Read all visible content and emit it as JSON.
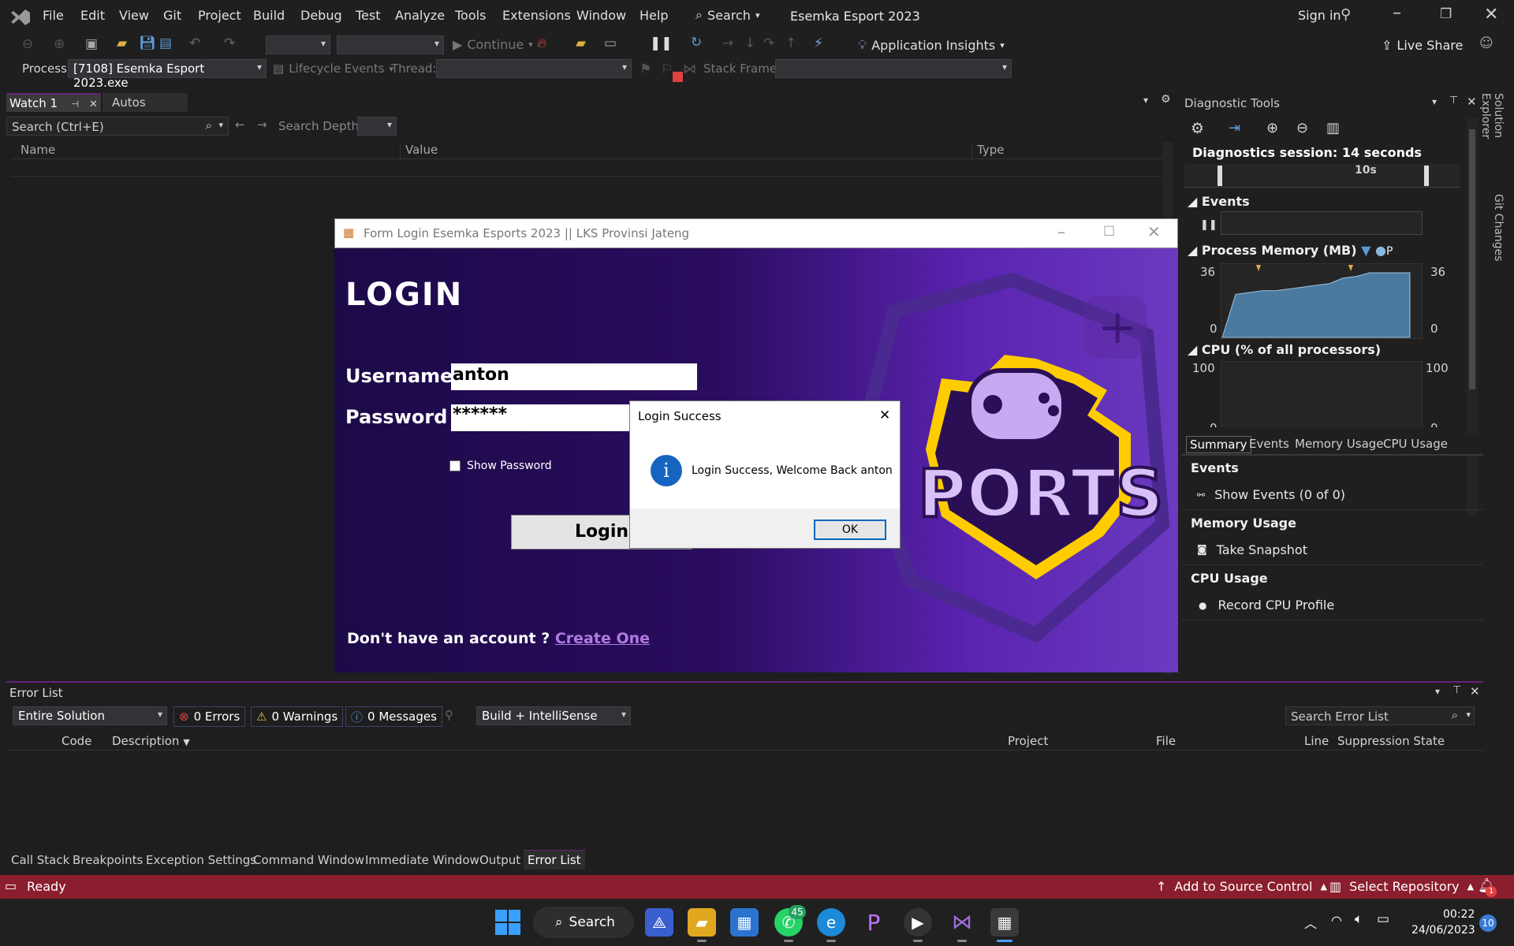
{
  "titlebar": {
    "search": "Search",
    "title": "Esemka Esport 2023",
    "sign_in": "Sign in"
  },
  "menu": [
    "File",
    "Edit",
    "View",
    "Git",
    "Project",
    "Build",
    "Debug",
    "Test",
    "Analyze",
    "Tools",
    "Extensions",
    "Window",
    "Help"
  ],
  "toolbar": {
    "continue": "Continue",
    "app_insights": "Application Insights",
    "live_share": "Live Share"
  },
  "debugbar": {
    "process_label": "Process:",
    "process": "[7108] Esemka Esport 2023.exe",
    "lifecycle": "Lifecycle Events",
    "thread": "Thread:",
    "stack_frame": "Stack Frame:"
  },
  "watch": {
    "tab_active": "Watch 1",
    "tab_other": "Autos",
    "search_placeholder": "Search (Ctrl+E)",
    "search_depth": "Search Depth:",
    "col_name": "Name",
    "col_value": "Value",
    "col_type": "Type"
  },
  "diag": {
    "title": "Diagnostic Tools",
    "session": "Diagnostics session: 14 seconds",
    "tick_10s": "10s",
    "events": "Events",
    "memory": "Process Memory (MB)",
    "mem_legend": "P",
    "mem_max": "36",
    "mem_min": "0",
    "cpu": "CPU (% of all processors)",
    "cpu_max": "100",
    "cpu_min": "0",
    "tabs": [
      "Summary",
      "Events",
      "Memory Usage",
      "CPU Usage"
    ],
    "sum_events": "Events",
    "show_events": "Show Events (0 of 0)",
    "sum_memory": "Memory Usage",
    "take_snapshot": "Take Snapshot",
    "sum_cpu": "CPU Usage",
    "record_cpu": "Record CPU Profile"
  },
  "side_tabs": [
    "Solution Explorer",
    "Git Changes"
  ],
  "errorlist": {
    "title": "Error List",
    "scope": "Entire Solution",
    "errors": "0 Errors",
    "warnings": "0 Warnings",
    "messages": "0 Messages",
    "build": "Build + IntelliSense",
    "search": "Search Error List",
    "cols": [
      "Code",
      "Description",
      "Project",
      "File",
      "Line",
      "Suppression State"
    ]
  },
  "bottom_tabs": [
    "Call Stack",
    "Breakpoints",
    "Exception Settings",
    "Command Window",
    "Immediate Window",
    "Output",
    "Error List"
  ],
  "status": {
    "ready": "Ready",
    "source_control": "Add to Source Control",
    "repo": "Select Repository",
    "notif": "1"
  },
  "login": {
    "window_title": "Form Login Esemka Esports 2023 || LKS Provinsi Jateng",
    "heading": "LOGIN",
    "username_label": "Username",
    "username": "anton",
    "password_label": "Password",
    "password": "******",
    "show_password": "Show Password",
    "login_btn": "Login",
    "no_account": "Don't have an account ?",
    "create": "Create One",
    "logo_text": "PORTS"
  },
  "msgbox": {
    "title": "Login Success",
    "message": "Login Success, Welcome Back anton",
    "ok": "OK"
  },
  "taskbar": {
    "search": "Search",
    "whatsapp_badge": "45",
    "time": "00:22",
    "date": "24/06/2023",
    "notif": "10"
  },
  "colors": {
    "accent": "#8b1e2e",
    "vs_purple": "#68217a",
    "login_bg": "#2a0c5e",
    "chart_fill": "#4b7a9e"
  },
  "chart_data": [
    {
      "type": "area",
      "title": "Process Memory (MB)",
      "x": [
        0,
        1,
        2,
        3,
        4,
        5,
        6,
        7,
        8,
        9,
        10,
        11,
        12,
        13,
        14
      ],
      "values": [
        0,
        24,
        25,
        26,
        26,
        27,
        28,
        29,
        30,
        33,
        34,
        36,
        36,
        36,
        36
      ],
      "ylim": [
        0,
        36
      ]
    },
    {
      "type": "line",
      "title": "CPU (% of all processors)",
      "x": [],
      "values": [],
      "ylim": [
        0,
        100
      ]
    }
  ]
}
